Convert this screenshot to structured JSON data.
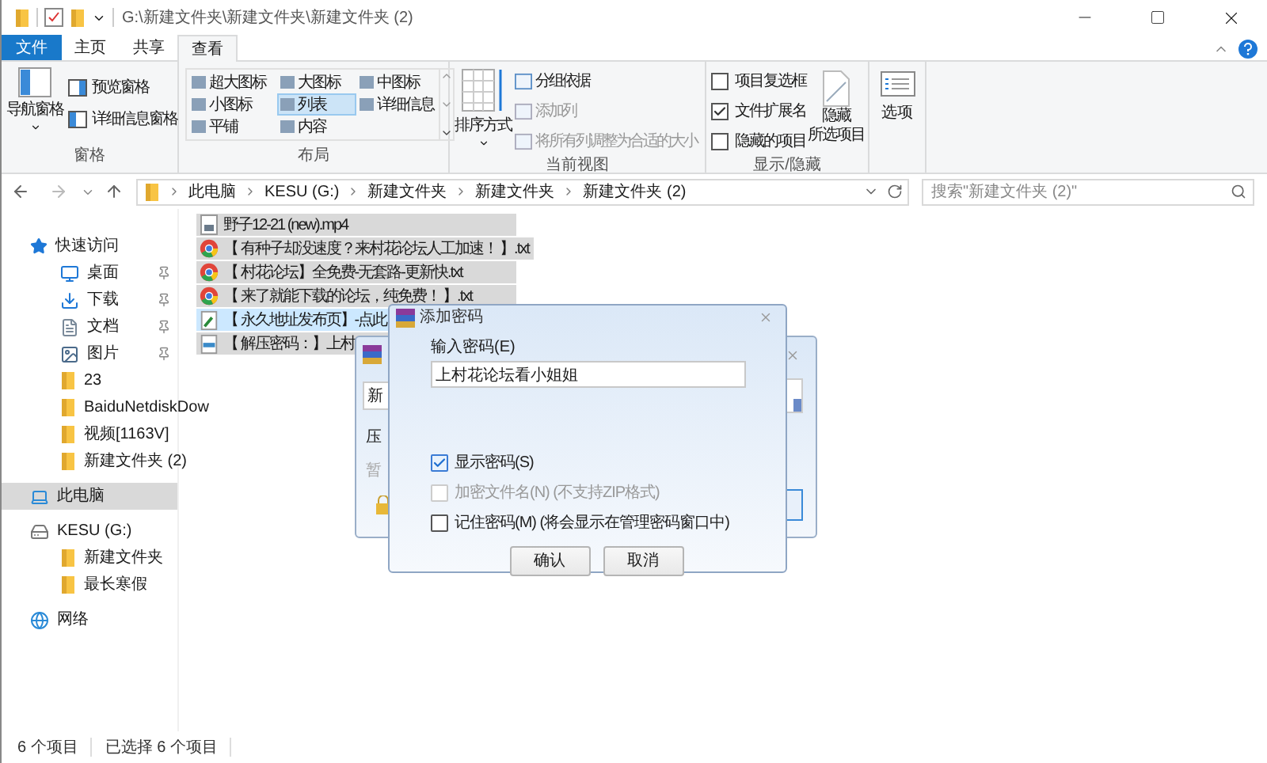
{
  "window": {
    "title": "G:\\新建文件夹\\新建文件夹\\新建文件夹 (2)"
  },
  "tabs": [
    {
      "label": "文件",
      "kind": "file",
      "selected": false
    },
    {
      "label": "主页",
      "kind": "tab",
      "selected": false
    },
    {
      "label": "共享",
      "kind": "tab",
      "selected": false
    },
    {
      "label": "查看",
      "kind": "tab",
      "selected": true
    }
  ],
  "ribbon": {
    "groups": [
      {
        "kind": "panes",
        "label": "窗格",
        "large": "导航窗格",
        "items": [
          "预览窗格",
          "详细信息窗格"
        ]
      },
      {
        "kind": "layout",
        "label": "布局",
        "items": [
          {
            "label": "超大图标",
            "selected": false
          },
          {
            "label": "大图标",
            "selected": false
          },
          {
            "label": "中图标",
            "selected": false
          },
          {
            "label": "小图标",
            "selected": false
          },
          {
            "label": "列表",
            "selected": true
          },
          {
            "label": "详细信息",
            "selected": false
          },
          {
            "label": "平铺",
            "selected": false
          },
          {
            "label": "内容",
            "selected": false
          }
        ]
      },
      {
        "kind": "view",
        "label": "当前视图",
        "large": "排序方式",
        "items": [
          {
            "label": "分组依据",
            "disabled": false
          },
          {
            "label": "添加列",
            "disabled": true
          },
          {
            "label": "将所有列调整为合适的大小",
            "disabled": true
          }
        ]
      },
      {
        "kind": "show",
        "label": "显示/隐藏",
        "checks": [
          {
            "label": "项目复选框",
            "checked": false
          },
          {
            "label": "文件扩展名",
            "checked": true
          },
          {
            "label": "隐藏的项目",
            "checked": false
          }
        ],
        "large_lines": [
          "隐藏",
          "所选项目"
        ]
      },
      {
        "kind": "options",
        "large": "选项"
      }
    ]
  },
  "address": {
    "segments": [
      "此电脑",
      "KESU (G:)",
      "新建文件夹",
      "新建文件夹",
      "新建文件夹 (2)"
    ]
  },
  "search": {
    "placeholder": "搜索\"新建文件夹 (2)\""
  },
  "nav": [
    {
      "label": "快速访问",
      "kind": "star",
      "selected": false,
      "children": [
        {
          "label": "桌面",
          "kind": "desktop",
          "pinned": true,
          "selected": false
        },
        {
          "label": "下载",
          "kind": "download",
          "pinned": true,
          "selected": false
        },
        {
          "label": "文档",
          "kind": "docs",
          "pinned": true,
          "selected": false
        },
        {
          "label": "图片",
          "kind": "pictures",
          "pinned": true,
          "selected": false
        },
        {
          "label": "23",
          "kind": "folder",
          "pinned": false,
          "selected": false
        },
        {
          "label": "BaiduNetdiskDow",
          "kind": "folder",
          "pinned": false,
          "selected": false
        },
        {
          "label": "视频[1163V]",
          "kind": "folder",
          "pinned": false,
          "selected": false
        },
        {
          "label": "新建文件夹 (2)",
          "kind": "folder",
          "pinned": false,
          "selected": false
        }
      ]
    },
    {
      "label": "此电脑",
      "kind": "pc",
      "selected": true
    },
    {
      "label": "KESU (G:)",
      "kind": "drive",
      "selected": false,
      "children": [
        {
          "label": "新建文件夹",
          "kind": "folder",
          "pinned": false,
          "selected": false
        },
        {
          "label": "最长寒假",
          "kind": "folder",
          "pinned": false,
          "selected": false
        }
      ]
    },
    {
      "label": "网络",
      "kind": "network",
      "selected": false
    }
  ],
  "files": [
    {
      "name": "野子12-21 (new).mp4",
      "kind": "video",
      "selected": true,
      "focused": false
    },
    {
      "name": "【 有种子却没速度？来村花论坛人工加速！ 】.txt",
      "kind": "chrome",
      "selected": true,
      "focused": false
    },
    {
      "name": "【 村花论坛】全免费-无套路-更新快.txt",
      "kind": "chrome",
      "selected": true,
      "focused": false
    },
    {
      "name": "【 来了就能下载的论坛，纯免费！ 】.txt",
      "kind": "chrome",
      "selected": true,
      "focused": false
    },
    {
      "name": "【 永久地址发布页】-点此",
      "kind": "link",
      "selected": true,
      "focused": true
    },
    {
      "name": "【 解压密码：】上村",
      "kind": "text",
      "selected": true,
      "focused": false
    }
  ],
  "back_dialog": {
    "field_text": "新",
    "label_1": "压",
    "label_2": "暂"
  },
  "dialog": {
    "title": "添加密码",
    "field_label": "输入密码(E)",
    "value": "上村花论坛看小姐姐",
    "checks": [
      {
        "label": "显示密码(S)",
        "checked": true,
        "disabled": false
      },
      {
        "label": "加密文件名(N) (不支持ZIP格式)",
        "checked": false,
        "disabled": true
      },
      {
        "label": "记住密码(M) (将会显示在管理密码窗口中)",
        "checked": false,
        "disabled": false
      }
    ],
    "buttons": [
      "确认",
      "取消"
    ]
  },
  "status_bar": {
    "count": "6 个项目",
    "selected": "已选择 6 个项目"
  }
}
